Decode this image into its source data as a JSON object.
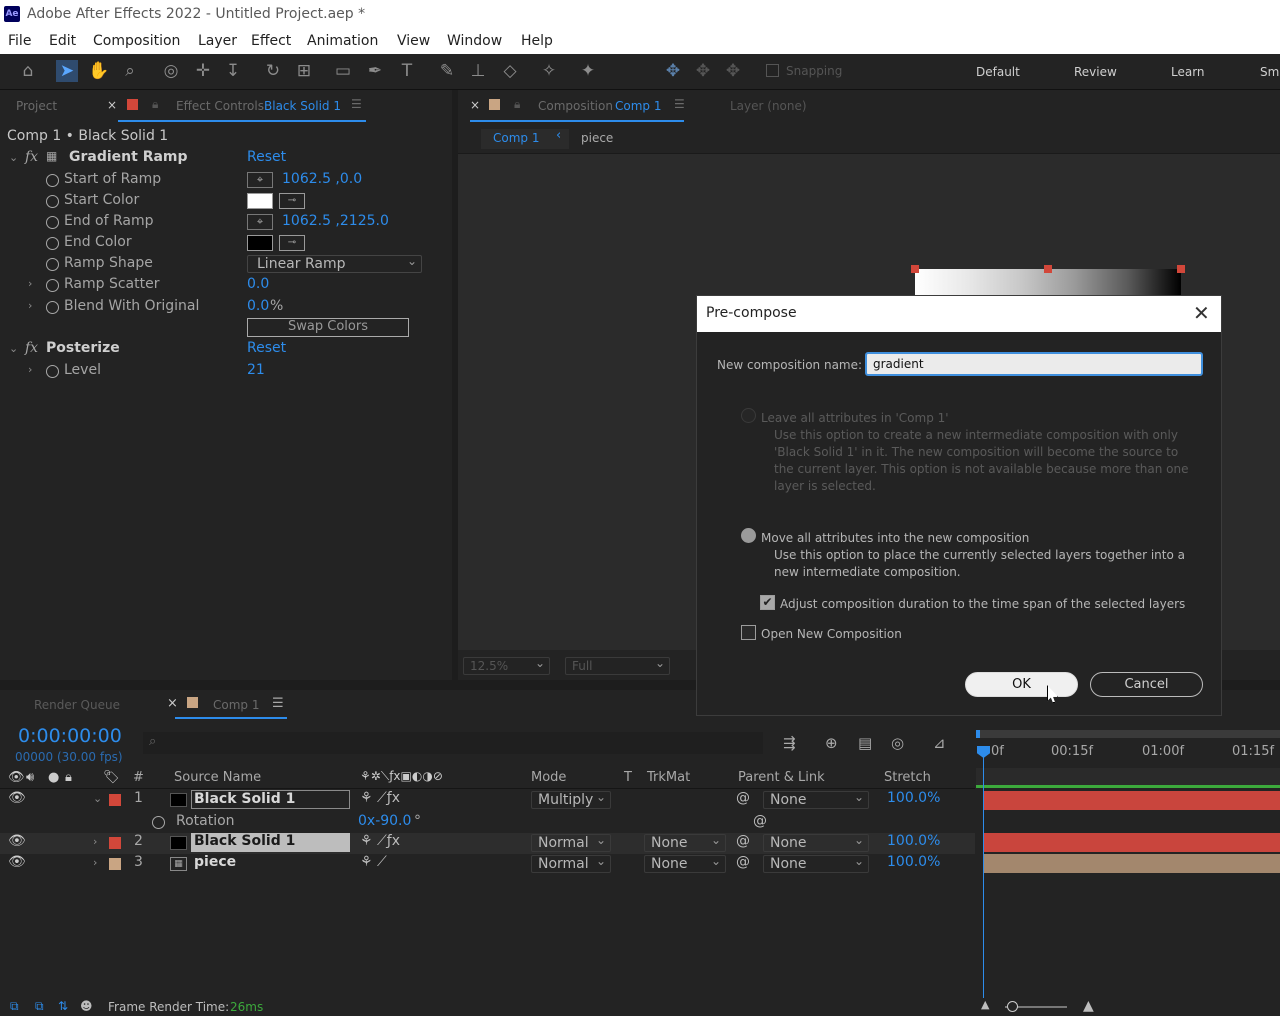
{
  "app": {
    "title": "Adobe After Effects 2022 - Untitled Project.aep *",
    "logo": "Ae"
  },
  "menu": [
    "File",
    "Edit",
    "Composition",
    "Layer",
    "Effect",
    "Animation",
    "View",
    "Window",
    "Help"
  ],
  "toolbar": {
    "snapping": "Snapping",
    "workspaces": [
      "Default",
      "Review",
      "Learn",
      "Sm"
    ]
  },
  "project_panel": {
    "tab_project": "Project",
    "tab_effect_controls": "Effect Controls",
    "effect_target": "Black Solid 1",
    "breadcrumb": "Comp 1 • Black Solid 1"
  },
  "effects": [
    {
      "name": "Gradient Ramp",
      "reset": "Reset",
      "props": [
        {
          "label": "Start of Ramp",
          "value": "1062.5 ,0.0"
        },
        {
          "label": "Start Color"
        },
        {
          "label": "End of Ramp",
          "value": "1062.5 ,2125.0"
        },
        {
          "label": "End Color"
        },
        {
          "label": "Ramp Shape",
          "value": "Linear Ramp"
        },
        {
          "label": "Ramp Scatter",
          "value": "0.0"
        },
        {
          "label": "Blend With Original",
          "value": "0.0",
          "unit": "%"
        }
      ],
      "swap": "Swap Colors"
    },
    {
      "name": "Posterize",
      "reset": "Reset",
      "props": [
        {
          "label": "Level",
          "value": "21"
        }
      ]
    }
  ],
  "comp_panel": {
    "tab": "Composition",
    "comp_name": "Comp 1",
    "layer_tab": "Layer (none)",
    "crumb_comp": "Comp 1",
    "crumb_piece": "piece",
    "zoom": "12.5%",
    "quality": "Full"
  },
  "timeline": {
    "tab_render": "Render Queue",
    "tab_comp": "Comp 1",
    "timecode": "0:00:00:00",
    "fps": "00000 (30.00 fps)",
    "columns": {
      "num": "#",
      "source": "Source Name",
      "mode": "Mode",
      "t": "T",
      "trkmat": "TrkMat",
      "parent": "Parent & Link",
      "stretch": "Stretch"
    },
    "ruler": [
      "0f",
      "00:15f",
      "01:00f",
      "01:15f"
    ],
    "layers": [
      {
        "num": "1",
        "name": "Black Solid 1",
        "mode": "Multiply",
        "trkmat": "",
        "parent": "None",
        "stretch": "100.0%",
        "color": "#d2473a"
      },
      {
        "num": "2",
        "name": "Black Solid 1",
        "mode": "Normal",
        "trkmat": "None",
        "parent": "None",
        "stretch": "100.0%",
        "color": "#d2473a"
      },
      {
        "num": "3",
        "name": "piece",
        "mode": "Normal",
        "trkmat": "None",
        "parent": "None",
        "stretch": "100.0%",
        "color": "#c9a583"
      }
    ],
    "rotation": {
      "label": "Rotation",
      "value": "0x-90.0",
      "unit": "°"
    }
  },
  "status": {
    "label": "Frame Render Time:",
    "value": "26ms"
  },
  "dialog": {
    "title": "Pre-compose",
    "name_label": "New composition name:",
    "name_value": "gradient",
    "opt1_label": "Leave all attributes in 'Comp 1'",
    "opt1_desc": "Use this option to create a new intermediate composition with only 'Black Solid 1' in it. The new composition will become the source to the current layer. This option is not available because more than one layer is selected.",
    "opt2_label": "Move all attributes into the new composition",
    "opt2_desc": "Use this option to place the currently selected layers together into a new intermediate composition.",
    "adjust_label": "Adjust composition duration to the time span of the selected layers",
    "open_label": "Open New Composition",
    "ok": "OK",
    "cancel": "Cancel"
  },
  "colors": {
    "accent": "#2d8ceb",
    "layer_red": "#d2473a",
    "layer_tan": "#c9a583",
    "playhead": "#2d8ceb"
  }
}
